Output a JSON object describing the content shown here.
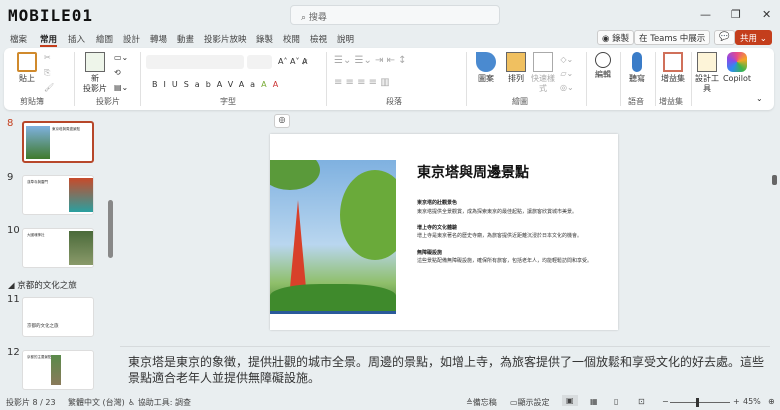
{
  "titlebar": {
    "logo": "MOBILE01",
    "search_placeholder": "搜尋",
    "minimize": "—",
    "restore": "❐",
    "close": "✕"
  },
  "tabs": [
    "檔案",
    "常用",
    "插入",
    "繪圖",
    "設計",
    "轉場",
    "動畫",
    "投影片放映",
    "錄製",
    "校閱",
    "檢視",
    "說明"
  ],
  "active_tab": "常用",
  "top_buttons": {
    "record": "◉ 錄製",
    "teams": "在 Teams 中展示",
    "comment": "💬",
    "share": "共用 ⌄"
  },
  "ribbon": {
    "paste": "貼上",
    "new_slide": "新\n投影片",
    "shapes": "圖案",
    "arrange": "排列",
    "quick_styles": "快速樣式",
    "editing": "編輯",
    "dictate": "聽寫",
    "addins": "增益集",
    "designer": "設計工具",
    "copilot": "Copilot",
    "groups": [
      "剪貼簿",
      "投影片",
      "字型",
      "段落",
      "繪圖",
      "語音",
      "增益集"
    ],
    "font_buttons": [
      "B",
      "I",
      "U",
      "S",
      "ab",
      "AV",
      "Aa",
      "A",
      "A"
    ]
  },
  "thumbnails": [
    {
      "num": "8",
      "title": "東京塔與周邊景點",
      "selected": true
    },
    {
      "num": "9",
      "title": "淺草寺與雷門"
    },
    {
      "num": "10",
      "title": "大國魂神社"
    },
    {
      "section": "京都的文化之旅"
    },
    {
      "num": "11",
      "title": "京都的文化之旅"
    },
    {
      "num": "12",
      "title": "京都的主要景點"
    }
  ],
  "slide": {
    "title": "東京塔與周邊景點",
    "points": [
      {
        "head": "東京塔的壯觀景色",
        "body": "東京塔提供全景觀賞，成為探索東京的最佳起點，讓旅客欣賞城市美景。"
      },
      {
        "head": "增上寺的文化體驗",
        "body": "增上寺是東京著名的歷史寺廟，為旅客提供近距離沉浸於日本文化的機會。"
      },
      {
        "head": "無障礙設施",
        "body": "這些景點配備無障礙設施，確保所有旅客，包括老年人，均能輕鬆訪問和享受。"
      }
    ]
  },
  "notes": "東京塔是東京的象徵，提供壯觀的城市全景。周邊的景點，如增上寺，為旅客提供了一個放鬆和享受文化的好去處。這些景點適合老年人並提供無障礙設施。",
  "status": {
    "slide": "投影片 8 / 23",
    "language": "繁體中文 (台灣)",
    "accessibility": "協助工具: 調查",
    "notes": "備忘稿",
    "display": "顯示設定",
    "zoom": "45%",
    "zoom_value": 45
  }
}
